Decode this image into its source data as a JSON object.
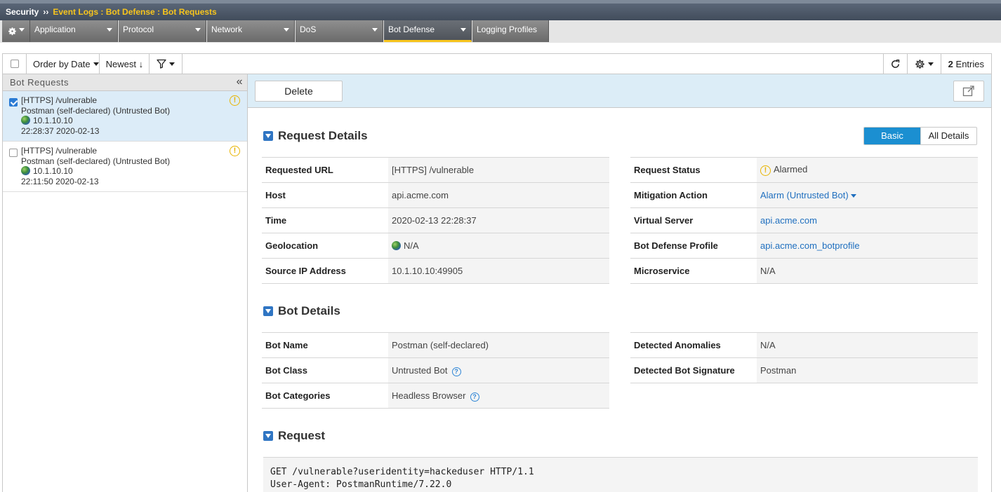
{
  "breadcrumb": {
    "root": "Security",
    "separator": "››",
    "path": "Event Logs : Bot Defense : Bot Requests"
  },
  "tabs": [
    {
      "label": "Application"
    },
    {
      "label": "Protocol"
    },
    {
      "label": "Network"
    },
    {
      "label": "DoS"
    },
    {
      "label": "Bot Defense",
      "active": true
    },
    {
      "label": "Logging Profiles"
    }
  ],
  "toolbar": {
    "order_by": "Order by Date",
    "sort": "Newest ↓",
    "entries_count": "2",
    "entries_label": "Entries"
  },
  "left_panel": {
    "title": "Bot Requests",
    "collapse_glyph": "«",
    "items": [
      {
        "url": "[HTTPS] /vulnerable",
        "bot": "Postman (self-declared) (Untrusted Bot)",
        "ip": "10.1.10.10",
        "time": "22:28:37 2020-02-13",
        "selected": true
      },
      {
        "url": "[HTTPS] /vulnerable",
        "bot": "Postman (self-declared) (Untrusted Bot)",
        "ip": "10.1.10.10",
        "time": "22:11:50 2020-02-13",
        "selected": false
      }
    ]
  },
  "actions": {
    "delete": "Delete"
  },
  "request_details": {
    "title": "Request Details",
    "toggle": {
      "basic": "Basic",
      "all": "All Details"
    },
    "left": [
      {
        "k": "Requested URL",
        "v": "[HTTPS] /vulnerable"
      },
      {
        "k": "Host",
        "v": "api.acme.com"
      },
      {
        "k": "Time",
        "v": "2020-02-13 22:28:37"
      },
      {
        "k": "Geolocation",
        "v": "N/A"
      },
      {
        "k": "Source IP Address",
        "v": "10.1.10.10:49905"
      }
    ],
    "right": [
      {
        "k": "Request Status",
        "v": "Alarmed"
      },
      {
        "k": "Mitigation Action",
        "v": "Alarm (Untrusted Bot)"
      },
      {
        "k": "Virtual Server",
        "v": "api.acme.com"
      },
      {
        "k": "Bot Defense Profile",
        "v": "api.acme.com_botprofile"
      },
      {
        "k": "Microservice",
        "v": "N/A"
      }
    ]
  },
  "bot_details": {
    "title": "Bot Details",
    "left": [
      {
        "k": "Bot Name",
        "v": "Postman (self-declared)"
      },
      {
        "k": "Bot Class",
        "v": "Untrusted Bot"
      },
      {
        "k": "Bot Categories",
        "v": "Headless Browser"
      }
    ],
    "right": [
      {
        "k": "Detected Anomalies",
        "v": "N/A"
      },
      {
        "k": "Detected Bot Signature",
        "v": "Postman"
      }
    ]
  },
  "request": {
    "title": "Request",
    "line1": "GET /vulnerable?useridentity=hackeduser HTTP/1.1",
    "line2": "User-Agent: PostmanRuntime/7.22.0"
  },
  "colors": {
    "accent": "#f8c51c",
    "link": "#1f6fbf",
    "toggle_active": "#1b8fd1",
    "warning": "#e8b400"
  }
}
